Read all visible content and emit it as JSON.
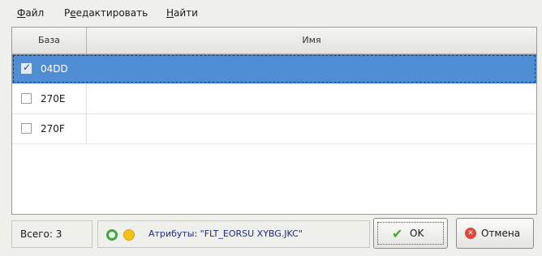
{
  "menu": {
    "file": {
      "label": "айл",
      "mnemonic": "Ф"
    },
    "edit": {
      "label": "едактировать",
      "prefix": "Р",
      "mnemonic": "е"
    },
    "find": {
      "label": "айти",
      "mnemonic": "Н"
    }
  },
  "table": {
    "columns": {
      "base": "База",
      "name": "Имя"
    },
    "rows": [
      {
        "base": "04DD",
        "name": "",
        "checked": true,
        "selected": true
      },
      {
        "base": "270E",
        "name": "",
        "checked": false,
        "selected": false
      },
      {
        "base": "270F",
        "name": "",
        "checked": false,
        "selected": false
      }
    ]
  },
  "status": {
    "total": "Всего: 3",
    "attributes": "Атрибуты: \"FLT_EORSU XYBG.JKC\"",
    "indicators": {
      "green": "#3fa83f",
      "yellow": "#f2c21a"
    }
  },
  "buttons": {
    "ok": {
      "label": "OK",
      "icon": "checkmark-icon"
    },
    "cancel": {
      "label": "Отмена",
      "icon": "stop-icon"
    }
  },
  "colors": {
    "selection": "#4f8ed4",
    "attribute_text": "#1c2a8a"
  }
}
